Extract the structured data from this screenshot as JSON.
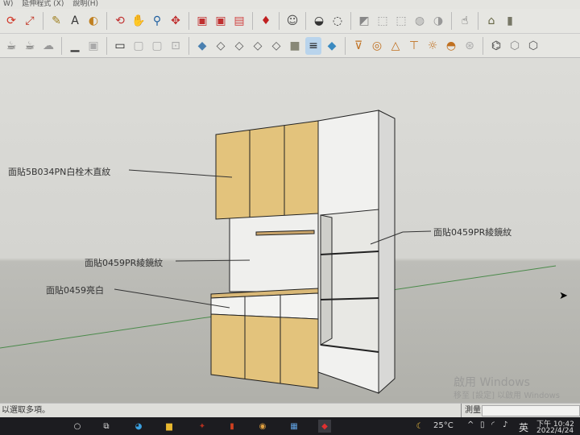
{
  "menu": {
    "items": [
      "W)",
      "延伸程式 (X)",
      "說明(H)"
    ]
  },
  "toolbar_row1": [
    "rotate-icon",
    "scale-icon",
    "tape-measure-icon",
    "text-icon",
    "paint-bucket-icon",
    "orbit-icon",
    "pan-icon",
    "zoom-icon",
    "zoom-extents-icon",
    "3d-warehouse-icon",
    "extension-warehouse-icon",
    "layout-icon",
    "ruby-icon",
    "account-icon",
    "solid-union-icon",
    "solid-subtract-icon",
    "section-plane-icon",
    "texture-icon",
    "texture-shaded-icon",
    "x-ray-icon",
    "back-edges-icon",
    "component-select-icon",
    "house-icon",
    "door-icon"
  ],
  "toolbar_row2": [
    "teapot-icon",
    "teapot-pointer-icon",
    "cloud-icon",
    "scene-icon",
    "scene-image-icon",
    "window-icon",
    "teapot-window-icon",
    "cloud-window-icon",
    "lock-icon",
    "iso-view-icon",
    "top-view-icon",
    "front-view-icon",
    "right-view-icon",
    "back-view-icon",
    "shaded-icon",
    "shaded-texture-icon",
    "monochrome-icon",
    "render-section-icon",
    "ring-icon",
    "cone-light-icon",
    "spot-light-icon",
    "sun-icon",
    "dome-icon",
    "sphere-icon",
    "camera-icon",
    "box-up-icon",
    "box-icon"
  ],
  "annotations": {
    "upper": "面貼5B034PN白栓木直紋",
    "back": "面貼0459PR綾鏡紋",
    "drawer": "面貼0459亮白",
    "right": "面貼0459PR綾鏡紋"
  },
  "watermark": {
    "title": "啟用 Windows",
    "subtitle": "移至 [設定] 以啟用 Windows"
  },
  "status": {
    "hint": "以選取多項。",
    "measure_label": "測量",
    "measure_value": ""
  },
  "taskbar": {
    "weather": "25°C",
    "ime": "英",
    "time": "下午 10:42",
    "date": "2022/4/24"
  },
  "colors": {
    "wood": "#e2c27c",
    "panel": "#f2f2f0",
    "edge": "#222222"
  }
}
